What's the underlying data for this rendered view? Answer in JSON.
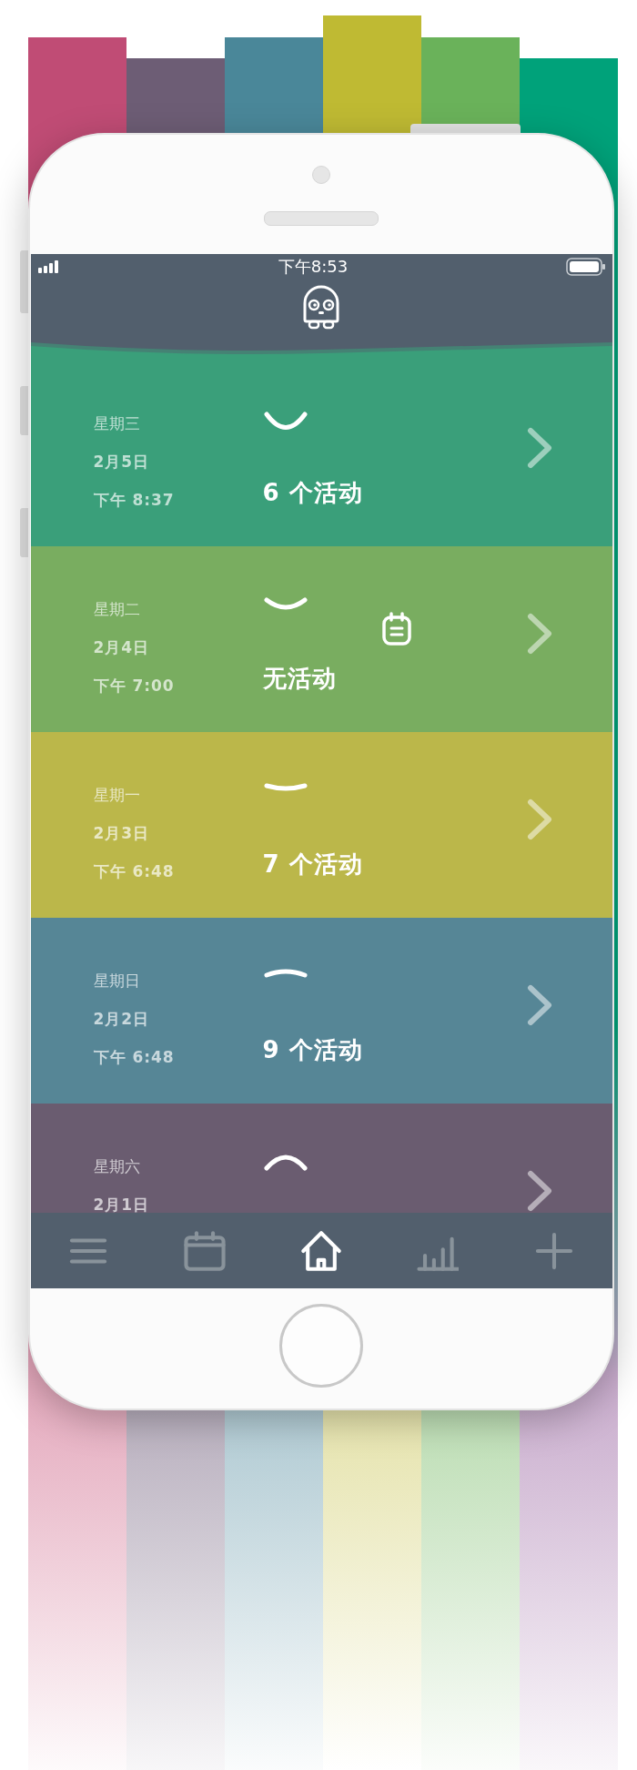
{
  "status_bar": {
    "time": "下午8:53"
  },
  "days": [
    {
      "weekday": "星期三",
      "date": "2月5日",
      "time": "下午 8:37",
      "kind": "smile",
      "activities": "6 个活动",
      "has_note": false,
      "color": "#3a9f7a"
    },
    {
      "weekday": "星期二",
      "date": "2月4日",
      "time": "下午 7:00",
      "kind": "slight",
      "activities": "无活动",
      "has_note": true,
      "color": "#79ad60"
    },
    {
      "weekday": "星期一",
      "date": "2月3日",
      "time": "下午 6:48",
      "kind": "flat",
      "activities": "7 个活动",
      "has_note": false,
      "color": "#bbb74a"
    },
    {
      "weekday": "星期日",
      "date": "2月2日",
      "time": "下午 6:48",
      "kind": "meh",
      "activities": "9 个活动",
      "has_note": false,
      "color": "#568696"
    },
    {
      "weekday": "星期六",
      "date": "2月1日",
      "kind": "frown",
      "has_note": false,
      "color": "#6a5c70"
    }
  ],
  "tab_bar": [
    {
      "kind": "menu",
      "selected": false
    },
    {
      "kind": "calendar",
      "selected": false
    },
    {
      "kind": "home",
      "selected": true
    },
    {
      "kind": "stats",
      "selected": false
    },
    {
      "kind": "add",
      "selected": false
    }
  ]
}
